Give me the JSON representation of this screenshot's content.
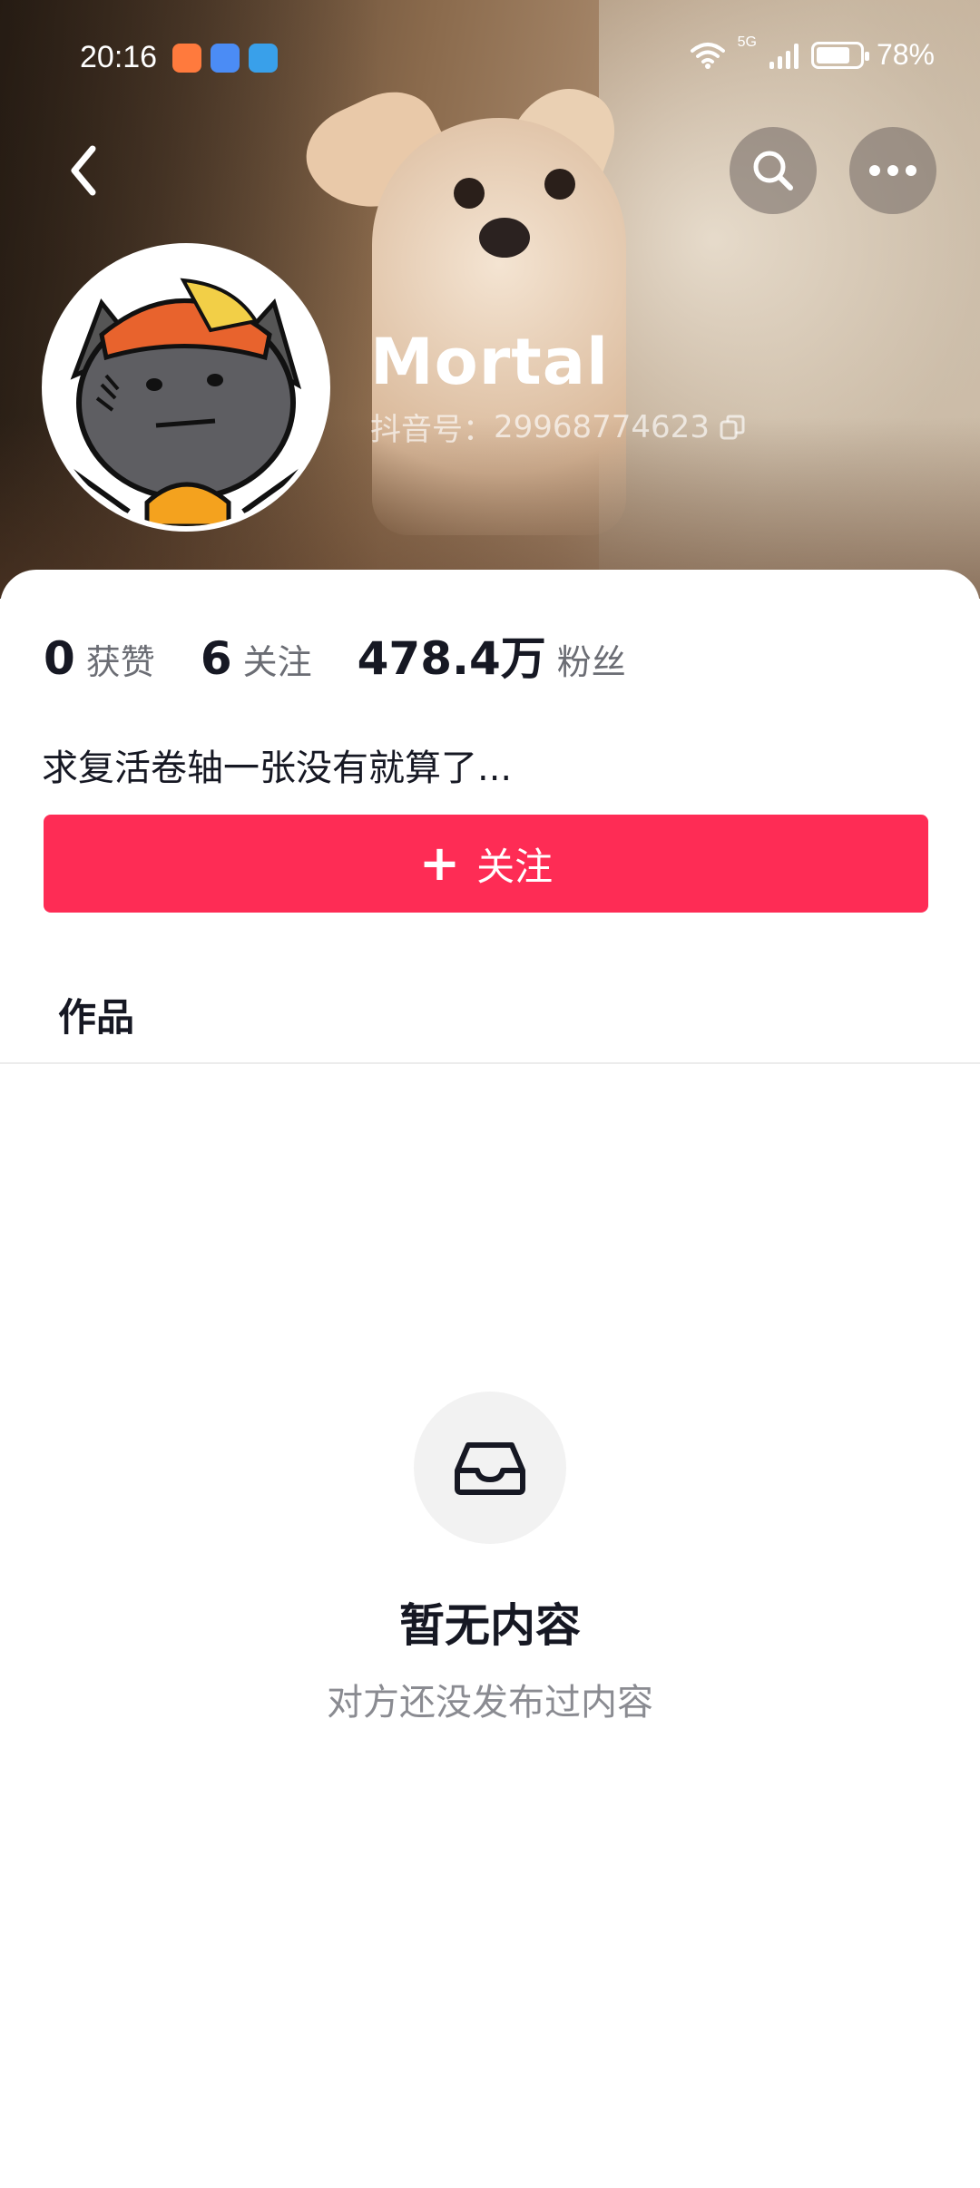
{
  "status_bar": {
    "time": "20:16",
    "network": "5G",
    "battery_percent": "78%",
    "battery_level": 0.78
  },
  "header": {
    "username": "Mortal",
    "account_id_label": "抖音号：",
    "account_id": "29968774623"
  },
  "stats": {
    "likes_value": "0",
    "likes_label": "获赞",
    "following_value": "6",
    "following_label": "关注",
    "followers_value": "478.4万",
    "followers_label": "粉丝"
  },
  "bio": "求复活卷轴一张没有就算了...",
  "follow_button": {
    "plus": "+",
    "label": "关注",
    "color": "#fe2c55"
  },
  "tabs": [
    {
      "label": "作品"
    }
  ],
  "empty_state": {
    "title": "暂无内容",
    "subtitle": "对方还没发布过内容"
  },
  "icons": {
    "back": "chevron-left-icon",
    "search": "search-icon",
    "more": "more-dots-icon",
    "copy": "copy-icon",
    "inbox": "inbox-tray-icon"
  }
}
